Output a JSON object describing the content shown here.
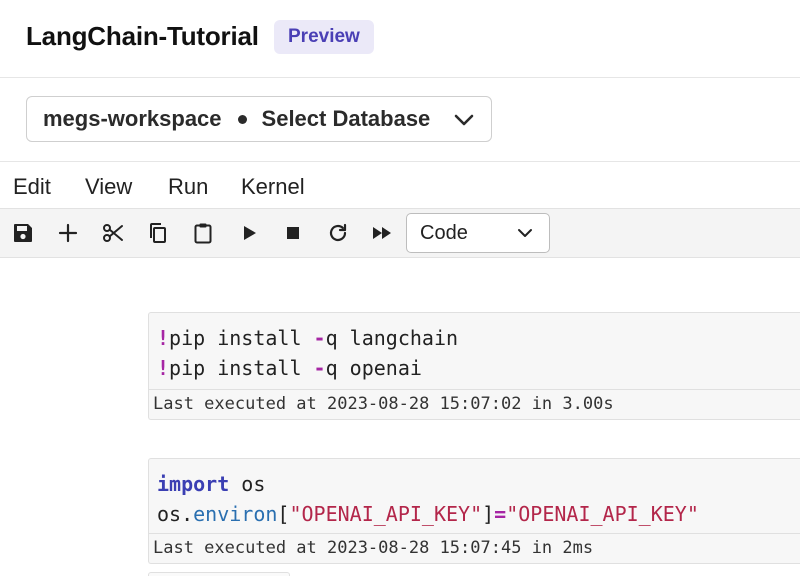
{
  "header": {
    "title": "LangChain-Tutorial",
    "badge": "Preview"
  },
  "workspace": {
    "name": "megs-workspace",
    "database": "Select Database",
    "icon": "chevron-down-icon"
  },
  "menu": {
    "edit": "Edit",
    "view": "View",
    "run": "Run",
    "kernel": "Kernel"
  },
  "toolbar": {
    "icons": [
      "save-icon",
      "add-icon",
      "cut-icon",
      "copy-icon",
      "paste-icon",
      "run-icon",
      "stop-icon",
      "restart-icon",
      "run-all-icon"
    ],
    "cell_type": "Code"
  },
  "cells": [
    {
      "lines": [
        {
          "bang": "!",
          "cmd": "pip install ",
          "op": "-",
          "rest": "q langchain"
        },
        {
          "bang": "!",
          "cmd": "pip install ",
          "op": "-",
          "rest": "q openai"
        }
      ],
      "output": "Last executed at 2023-08-28 15:07:02 in 3.00s"
    },
    {
      "line1": {
        "kw": "import",
        "rest": " os"
      },
      "line2": {
        "obj": "os.",
        "attr": "environ",
        "open": "[",
        "key": "\"OPENAI_API_KEY\"",
        "close": "]",
        "eq": "=",
        "val": "\"OPENAI_API_KEY\""
      },
      "output": "Last executed at 2023-08-28 15:07:45 in 2ms"
    }
  ],
  "colors": {
    "badge_bg": "#ebe9f8",
    "badge_text": "#4a3fb5",
    "magic": "#a626a4",
    "keyword": "#3b3fb3",
    "string": "#b3264a",
    "attribute": "#2a6fb0"
  }
}
